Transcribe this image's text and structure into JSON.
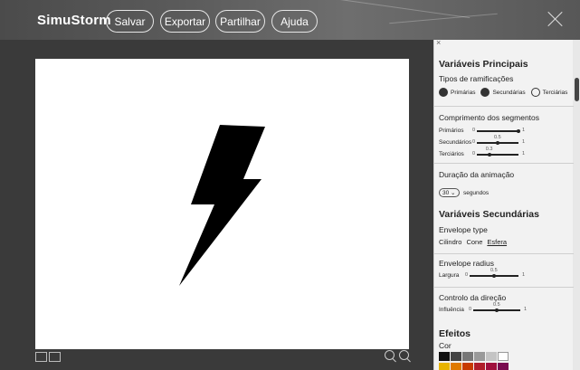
{
  "app": {
    "brand": "SimuStorm"
  },
  "header": {
    "buttons": {
      "save": "Salvar",
      "export": "Exportar",
      "share": "Partilhar",
      "help": "Ajuda"
    }
  },
  "panel": {
    "close_glyph": "×",
    "main_vars": {
      "title": "Variáveis Principais",
      "branch_types_label": "Tipos de ramificações",
      "options": [
        "Primárias",
        "Secundárias",
        "Terciárias"
      ]
    },
    "segment_length": {
      "title": "Comprimento dos segmentos",
      "rows": [
        {
          "name": "Primários",
          "min": "0",
          "max": "1",
          "value": 1.0,
          "value_label": ""
        },
        {
          "name": "Secundários",
          "min": "0",
          "max": "1",
          "value": 0.5,
          "value_label": "0.5"
        },
        {
          "name": "Terciários",
          "min": "0",
          "max": "1",
          "value": 0.3,
          "value_label": "0.3"
        }
      ]
    },
    "anim": {
      "title": "Duração da animação",
      "value": "30",
      "unit": "segundos"
    },
    "secondary": {
      "title": "Variáveis Secundárias",
      "envelope_type_label": "Envelope type",
      "envelope_options": [
        "Cilindro",
        "Cone",
        "Esfera"
      ],
      "envelope_radius_label": "Envelope radius",
      "radius": {
        "name": "Largura",
        "min": "0",
        "max": "1",
        "value": 0.5,
        "value_label": "0.5"
      },
      "direction_label": "Controlo da direção",
      "influence": {
        "name": "Influência",
        "min": "0",
        "max": "1",
        "value": 0.5,
        "value_label": "0.5"
      }
    },
    "effects": {
      "title": "Efeitos",
      "color_label": "Cor",
      "swatches_row1": [
        "#111111",
        "#444444",
        "#777777",
        "#9a9a9a",
        "#c4c4c4",
        "#ffffff"
      ],
      "swatches_row2": [
        "#e8b400",
        "#e07a00",
        "#c73b00",
        "#b01e2a",
        "#a0103e",
        "#7a0c50"
      ]
    }
  }
}
